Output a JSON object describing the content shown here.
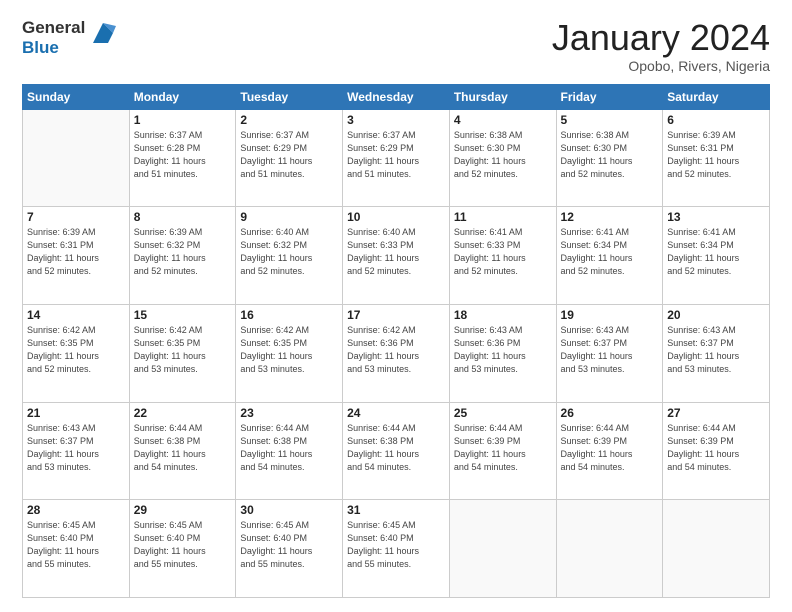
{
  "header": {
    "logo_line1": "General",
    "logo_line2": "Blue",
    "month_title": "January 2024",
    "location": "Opobo, Rivers, Nigeria"
  },
  "days_of_week": [
    "Sunday",
    "Monday",
    "Tuesday",
    "Wednesday",
    "Thursday",
    "Friday",
    "Saturday"
  ],
  "weeks": [
    [
      {
        "day": "",
        "info": ""
      },
      {
        "day": "1",
        "info": "Sunrise: 6:37 AM\nSunset: 6:28 PM\nDaylight: 11 hours\nand 51 minutes."
      },
      {
        "day": "2",
        "info": "Sunrise: 6:37 AM\nSunset: 6:29 PM\nDaylight: 11 hours\nand 51 minutes."
      },
      {
        "day": "3",
        "info": "Sunrise: 6:37 AM\nSunset: 6:29 PM\nDaylight: 11 hours\nand 51 minutes."
      },
      {
        "day": "4",
        "info": "Sunrise: 6:38 AM\nSunset: 6:30 PM\nDaylight: 11 hours\nand 52 minutes."
      },
      {
        "day": "5",
        "info": "Sunrise: 6:38 AM\nSunset: 6:30 PM\nDaylight: 11 hours\nand 52 minutes."
      },
      {
        "day": "6",
        "info": "Sunrise: 6:39 AM\nSunset: 6:31 PM\nDaylight: 11 hours\nand 52 minutes."
      }
    ],
    [
      {
        "day": "7",
        "info": "Sunrise: 6:39 AM\nSunset: 6:31 PM\nDaylight: 11 hours\nand 52 minutes."
      },
      {
        "day": "8",
        "info": "Sunrise: 6:39 AM\nSunset: 6:32 PM\nDaylight: 11 hours\nand 52 minutes."
      },
      {
        "day": "9",
        "info": "Sunrise: 6:40 AM\nSunset: 6:32 PM\nDaylight: 11 hours\nand 52 minutes."
      },
      {
        "day": "10",
        "info": "Sunrise: 6:40 AM\nSunset: 6:33 PM\nDaylight: 11 hours\nand 52 minutes."
      },
      {
        "day": "11",
        "info": "Sunrise: 6:41 AM\nSunset: 6:33 PM\nDaylight: 11 hours\nand 52 minutes."
      },
      {
        "day": "12",
        "info": "Sunrise: 6:41 AM\nSunset: 6:34 PM\nDaylight: 11 hours\nand 52 minutes."
      },
      {
        "day": "13",
        "info": "Sunrise: 6:41 AM\nSunset: 6:34 PM\nDaylight: 11 hours\nand 52 minutes."
      }
    ],
    [
      {
        "day": "14",
        "info": "Sunrise: 6:42 AM\nSunset: 6:35 PM\nDaylight: 11 hours\nand 52 minutes."
      },
      {
        "day": "15",
        "info": "Sunrise: 6:42 AM\nSunset: 6:35 PM\nDaylight: 11 hours\nand 53 minutes."
      },
      {
        "day": "16",
        "info": "Sunrise: 6:42 AM\nSunset: 6:35 PM\nDaylight: 11 hours\nand 53 minutes."
      },
      {
        "day": "17",
        "info": "Sunrise: 6:42 AM\nSunset: 6:36 PM\nDaylight: 11 hours\nand 53 minutes."
      },
      {
        "day": "18",
        "info": "Sunrise: 6:43 AM\nSunset: 6:36 PM\nDaylight: 11 hours\nand 53 minutes."
      },
      {
        "day": "19",
        "info": "Sunrise: 6:43 AM\nSunset: 6:37 PM\nDaylight: 11 hours\nand 53 minutes."
      },
      {
        "day": "20",
        "info": "Sunrise: 6:43 AM\nSunset: 6:37 PM\nDaylight: 11 hours\nand 53 minutes."
      }
    ],
    [
      {
        "day": "21",
        "info": "Sunrise: 6:43 AM\nSunset: 6:37 PM\nDaylight: 11 hours\nand 53 minutes."
      },
      {
        "day": "22",
        "info": "Sunrise: 6:44 AM\nSunset: 6:38 PM\nDaylight: 11 hours\nand 54 minutes."
      },
      {
        "day": "23",
        "info": "Sunrise: 6:44 AM\nSunset: 6:38 PM\nDaylight: 11 hours\nand 54 minutes."
      },
      {
        "day": "24",
        "info": "Sunrise: 6:44 AM\nSunset: 6:38 PM\nDaylight: 11 hours\nand 54 minutes."
      },
      {
        "day": "25",
        "info": "Sunrise: 6:44 AM\nSunset: 6:39 PM\nDaylight: 11 hours\nand 54 minutes."
      },
      {
        "day": "26",
        "info": "Sunrise: 6:44 AM\nSunset: 6:39 PM\nDaylight: 11 hours\nand 54 minutes."
      },
      {
        "day": "27",
        "info": "Sunrise: 6:44 AM\nSunset: 6:39 PM\nDaylight: 11 hours\nand 54 minutes."
      }
    ],
    [
      {
        "day": "28",
        "info": "Sunrise: 6:45 AM\nSunset: 6:40 PM\nDaylight: 11 hours\nand 55 minutes."
      },
      {
        "day": "29",
        "info": "Sunrise: 6:45 AM\nSunset: 6:40 PM\nDaylight: 11 hours\nand 55 minutes."
      },
      {
        "day": "30",
        "info": "Sunrise: 6:45 AM\nSunset: 6:40 PM\nDaylight: 11 hours\nand 55 minutes."
      },
      {
        "day": "31",
        "info": "Sunrise: 6:45 AM\nSunset: 6:40 PM\nDaylight: 11 hours\nand 55 minutes."
      },
      {
        "day": "",
        "info": ""
      },
      {
        "day": "",
        "info": ""
      },
      {
        "day": "",
        "info": ""
      }
    ]
  ]
}
